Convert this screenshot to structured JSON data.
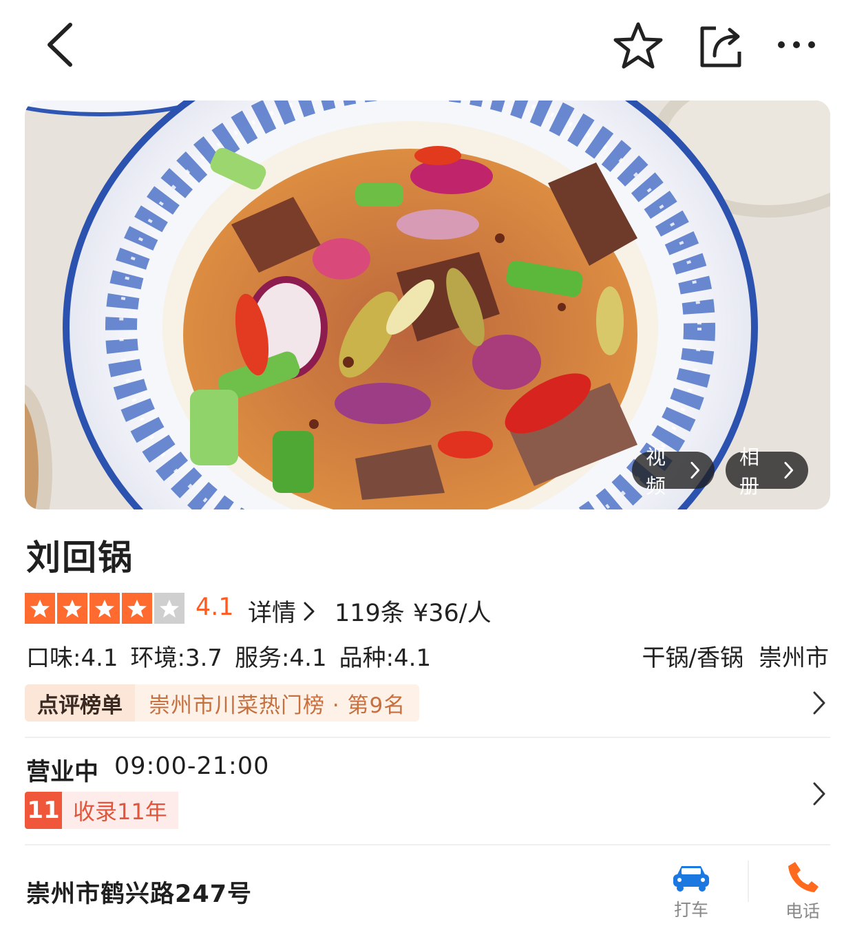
{
  "nav": {
    "back_icon": "back-arrow-icon",
    "favorite_icon": "star-outline-icon",
    "share_icon": "share-icon",
    "more_icon": "more-dots-icon"
  },
  "hero": {
    "video_label": "视频",
    "album_label": "相册"
  },
  "restaurant": {
    "name": "刘回锅",
    "rating": "4.1",
    "stars_filled": 4,
    "stars_total": 5,
    "detail_label": "详情",
    "review_count": "119条",
    "price_per_person": "¥36/人",
    "subscores": [
      "口味:4.1",
      "环境:3.7",
      "服务:4.1",
      "品种:4.1"
    ],
    "category": "干锅/香锅",
    "city": "崇州市"
  },
  "ranking": {
    "logo_text": "点评榜单",
    "text": "崇州市川菜热门榜 · 第9名"
  },
  "hours": {
    "status": "营业中",
    "time": "09:00-21:00"
  },
  "listing": {
    "years_icon_text": "11",
    "years_text": "收录11年"
  },
  "location": {
    "address": "崇州市鹤兴路247号",
    "taxi_label": "打车",
    "phone_label": "电话"
  },
  "colors": {
    "accent_orange": "#ff5a1f",
    "star_orange": "#ff6a2e",
    "taxi_blue": "#1a78e0",
    "phone_orange": "#ff6a1f"
  }
}
